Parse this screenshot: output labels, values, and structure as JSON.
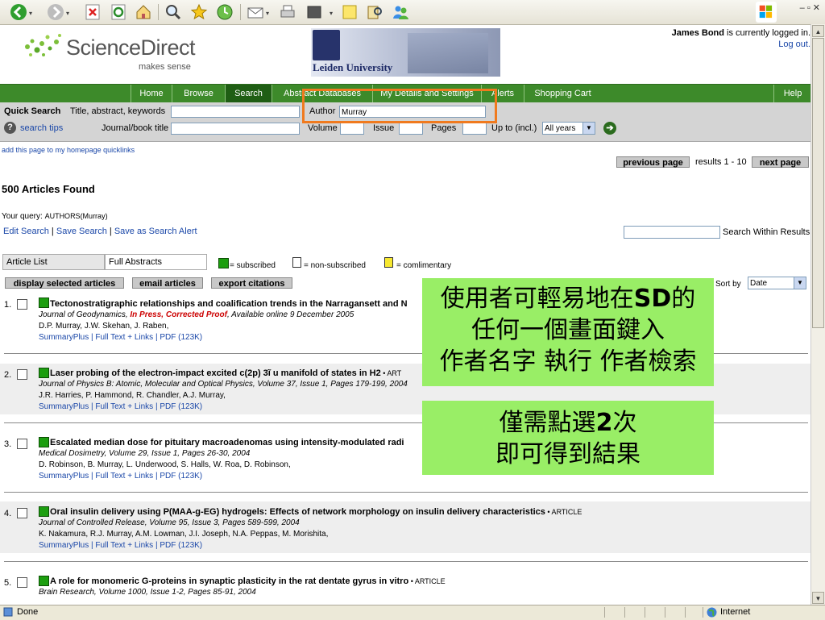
{
  "browser": {
    "status_text": "Done",
    "zone_text": "Internet",
    "window_controls": "– ▫ ✕"
  },
  "header": {
    "logo_text": "ScienceDirect",
    "logo_tagline": "makes sense",
    "institution": "Leiden University",
    "user_name": "James Bond",
    "logged_in_text": " is currently logged in.",
    "logout": "Log out."
  },
  "nav": {
    "items": [
      "Home",
      "Browse",
      "Search",
      "Abstract Databases",
      "My Details and Settings",
      "Alerts",
      "Shopping Cart"
    ],
    "help": "Help"
  },
  "quick_search": {
    "title": "Quick Search",
    "tak_label": "Title, abstract, keywords",
    "tak_value": "",
    "author_label": "Author",
    "author_value": "Murray",
    "search_tips": "search tips",
    "journal_label": "Journal/book title",
    "journal_value": "",
    "volume_label": "Volume",
    "issue_label": "Issue",
    "pages_label": "Pages",
    "upto_label": "Up to (incl.)",
    "years_value": "All years"
  },
  "quicklinks": "add this page to my homepage quicklinks",
  "pager": {
    "prev": "previous page",
    "range": "results 1 - 10",
    "next": "next page"
  },
  "results": {
    "count": "500 Articles Found",
    "query_label": "Your query: ",
    "query_value": "AUTHORS(Murray)",
    "edit_search": "Edit Search",
    "save_search": "Save Search",
    "save_alert": "Save as Search Alert",
    "within_label": "Search Within Results",
    "within_value": ""
  },
  "view": {
    "article_list": "Article List",
    "full_abstracts": "Full Abstracts",
    "legend_subscribed": "= subscribed",
    "legend_nonsub": "= non-subscribed",
    "legend_compl": "= comlimentary",
    "btn_display": "display selected articles",
    "btn_email": "email articles",
    "btn_export": "export citations",
    "sort_label": "Sort by",
    "sort_value": "Date"
  },
  "articles": [
    {
      "num": "1.",
      "title": "Tectonostratigraphic relationships and coalification trends in the Narragansett and N",
      "type": "",
      "source": "Journal of Geodynamics, ",
      "source_flag": "In Press, Corrected Proof",
      "source_tail": ", Available online 9 December 2005",
      "authors": "D.P. Murray, J.W. Skehan, J. Raben,",
      "links": "SummaryPlus | Full Text + Links | PDF (123K)"
    },
    {
      "num": "2.",
      "title": "Laser probing of the electron-impact excited c(2p) 3ĩ u manifold of states in H2",
      "type": " • ART",
      "source": "Journal of Physics B: Atomic, Molecular and Optical Physics, Volume 37, Issue 1, Pages 179-199, 2004",
      "source_flag": "",
      "source_tail": "",
      "authors": "J.R. Harries, P. Hammond, R. Chandler, A.J. Murray,",
      "links": "SummaryPlus | Full Text + Links | PDF (123K)"
    },
    {
      "num": "3.",
      "title": "Escalated median dose for pituitary macroadenomas using intensity-modulated radi",
      "type": "",
      "source": "Medical Dosimetry, Volume 29, Issue 1, Pages 26-30, 2004",
      "source_flag": "",
      "source_tail": "",
      "authors": "D. Robinson, B. Murray, L. Underwood, S. Halls, W. Roa, D. Robinson,",
      "links": "SummaryPlus | Full Text + Links | PDF (123K)"
    },
    {
      "num": "4.",
      "title": "Oral insulin delivery using P(MAA-g-EG) hydrogels: Effects of network morphology on insulin delivery characteristics",
      "type": " • ARTICLE",
      "source": "Journal of Controlled Release, Volume 95, Issue 3, Pages 589-599, 2004",
      "source_flag": "",
      "source_tail": "",
      "authors": "K. Nakamura, R.J. Murray, A.M. Lowman, J.I. Joseph, N.A. Peppas, M. Morishita,",
      "links": "SummaryPlus | Full Text + Links | PDF (123K)"
    },
    {
      "num": "5.",
      "title": "A role for monomeric G-proteins in synaptic plasticity in the rat dentate gyrus in vitro",
      "type": " • ARTICLE",
      "source": "Brain Research, Volume 1000, Issue 1-2, Pages 85-91, 2004",
      "source_flag": "",
      "source_tail": "",
      "authors": "",
      "links": ""
    }
  ],
  "overlay1": {
    "line1a": "使用者可輕易地在",
    "line1b": "SD",
    "line1c": "的",
    "line2": "任何一個畫面鍵入",
    "line3": "作者名字 執行 作者檢索"
  },
  "overlay2": {
    "line1a": "僅需點選",
    "line1b": "2",
    "line1c": "次",
    "line2": "即可得到結果"
  },
  "colors": {
    "nav_green": "#3d8a2a",
    "overlay_green": "#99ee66",
    "highlight_orange": "#f07a1e",
    "link_blue": "#1a47a8"
  }
}
